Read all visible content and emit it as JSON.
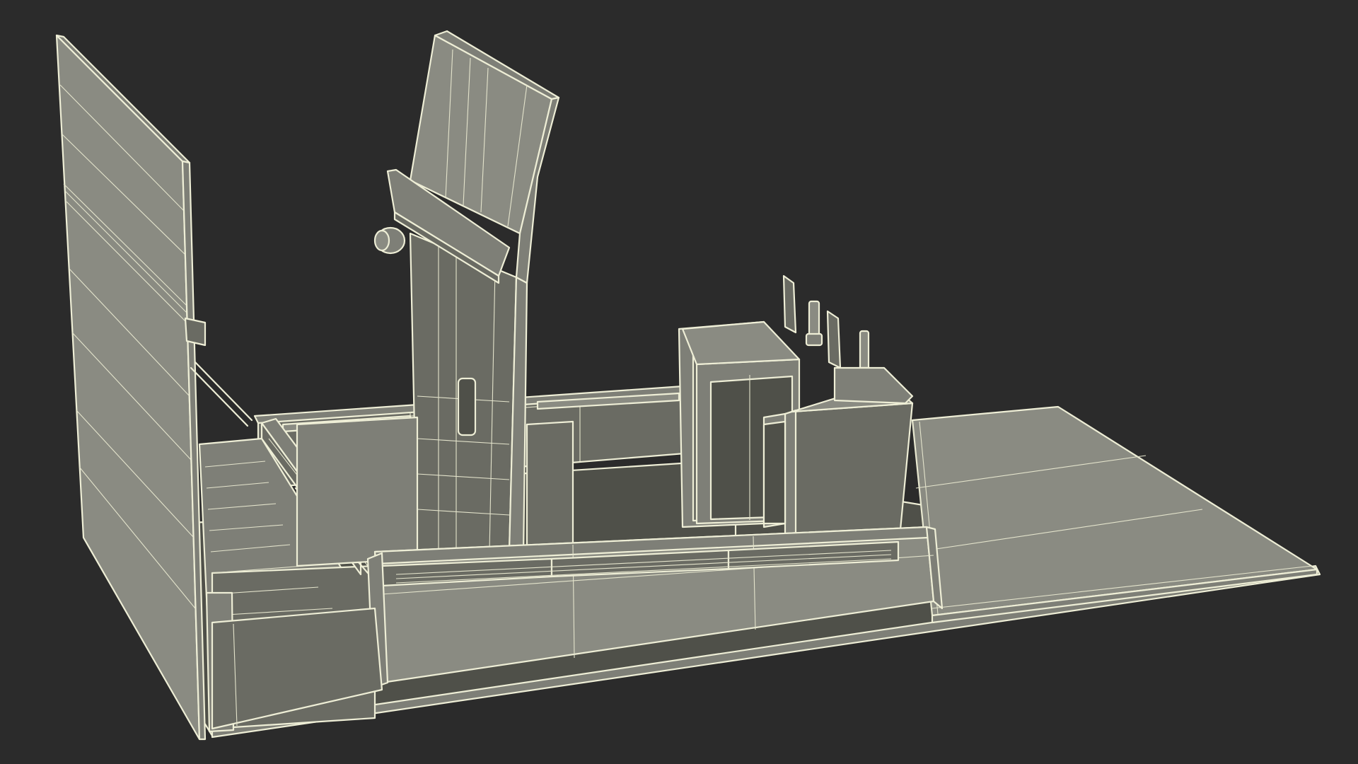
{
  "scene": {
    "background_color": "#2b2b2b",
    "surface_color": "#7b7c74",
    "shadow_color": "#4f5049",
    "wire_color": "#eeeed6"
  }
}
